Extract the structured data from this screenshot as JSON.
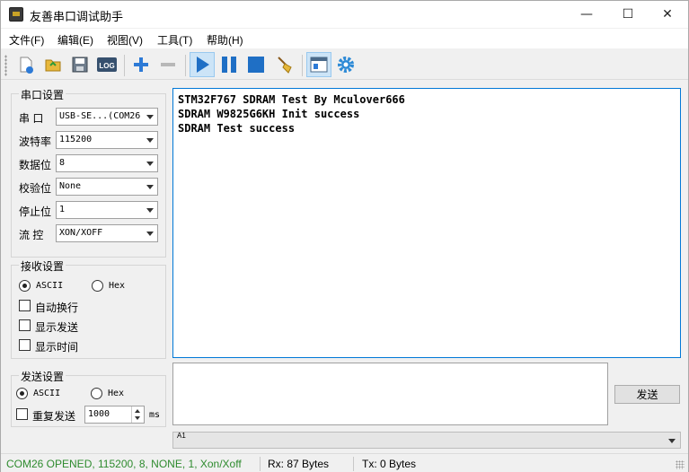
{
  "window": {
    "title": "友善串口调试助手",
    "minimize_glyph": "—",
    "maximize_glyph": "☐",
    "close_glyph": "✕"
  },
  "menu": [
    {
      "label": "文件(F)"
    },
    {
      "label": "编辑(E)"
    },
    {
      "label": "视图(V)"
    },
    {
      "label": "工具(T)"
    },
    {
      "label": "帮助(H)"
    }
  ],
  "toolbar": {
    "icons": [
      "new-icon",
      "open-icon",
      "save-icon",
      "log-icon",
      "add-icon",
      "remove-icon",
      "play-icon",
      "pause-icon",
      "stop-icon",
      "clear-broom-icon",
      "window-layout-icon",
      "settings-gear-icon"
    ],
    "log_text": "LOG",
    "accent": "#1f6fc5"
  },
  "serial": {
    "title": "串口设置",
    "port_label": "串  口",
    "port_value": "USB-SE...(COM26",
    "baud_label": "波特率",
    "baud_value": "115200",
    "databits_label": "数据位",
    "databits_value": "8",
    "parity_label": "校验位",
    "parity_value": "None",
    "stopbits_label": "停止位",
    "stopbits_value": "1",
    "flow_label": "流  控",
    "flow_value": "XON/XOFF"
  },
  "receive": {
    "title": "接收设置",
    "ascii_label": "ASCII",
    "hex_label": "Hex",
    "auto_wrap_label": "自动换行",
    "show_send_label": "显示发送",
    "show_time_label": "显示时间",
    "lines": [
      "STM32F767 SDRAM Test By Mculover666",
      "SDRAM W9825G6KH Init success",
      "SDRAM Test success"
    ]
  },
  "send": {
    "title": "发送设置",
    "ascii_label": "ASCII",
    "hex_label": "Hex",
    "repeat_label": "重复发送",
    "interval_value": "1000",
    "interval_unit": "ms",
    "send_button": "发送",
    "history_value": "A1"
  },
  "status": {
    "port_status": "COM26 OPENED, 115200, 8, NONE, 1, Xon/Xoff",
    "port_status_color": "#2e8b2e",
    "rx": "Rx: 87 Bytes",
    "tx": "Tx: 0 Bytes"
  }
}
